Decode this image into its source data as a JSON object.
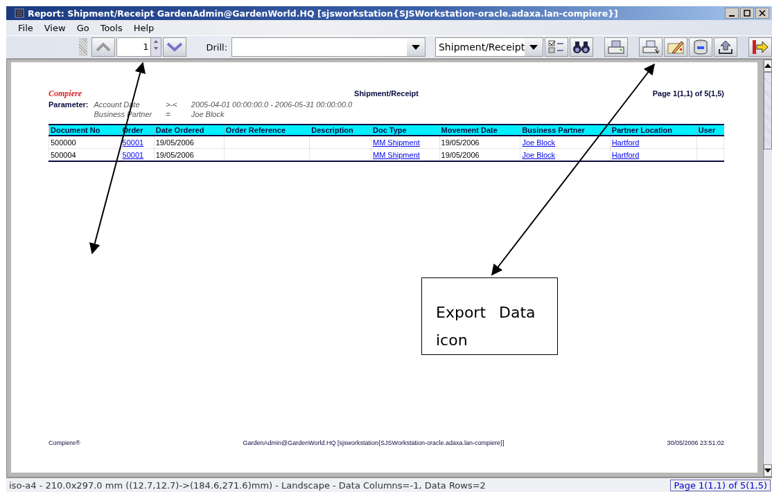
{
  "window": {
    "title": "Report: Shipment/Receipt  GardenAdmin@GardenWorld.HQ [sjsworkstation{SJSWorkstation-oracle.adaxa.lan-compiere}]"
  },
  "menu": [
    {
      "label": "File"
    },
    {
      "label": "View"
    },
    {
      "label": "Go"
    },
    {
      "label": "Tools"
    },
    {
      "label": "Help"
    }
  ],
  "toolbar": {
    "page_value": "1",
    "drill_label": "Drill:",
    "report_select": "Shipment/Receipt"
  },
  "report": {
    "logo": "Compiere",
    "title": "Shipment/Receipt",
    "page": "Page 1(1,1) of 5(1,5)",
    "parameter_label": "Parameter:",
    "parameters": [
      {
        "name": "Account Date",
        "op": ">-<",
        "value": "2005-04-01 00:00:00.0 - 2006-05-31 00:00:00.0"
      },
      {
        "name": "Business Partner",
        "op": "=",
        "value": "Joe Block"
      }
    ],
    "table": {
      "columns": [
        "Document No",
        "Order",
        "Date Ordered",
        "Order Reference",
        "Description",
        "Doc Type",
        "Movement Date",
        "Business Partner",
        "Partner Location",
        "User"
      ],
      "rows": [
        [
          {
            "text": "500000",
            "link": false
          },
          {
            "text": "50001",
            "link": true
          },
          {
            "text": "19/05/2006",
            "link": false
          },
          null,
          null,
          {
            "text": "MM Shipment",
            "link": true
          },
          {
            "text": "19/05/2006",
            "link": false
          },
          {
            "text": "Joe Block",
            "link": true
          },
          {
            "text": "Hartford",
            "link": true
          },
          null
        ],
        [
          {
            "text": "500004",
            "link": false
          },
          {
            "text": "50001",
            "link": true
          },
          {
            "text": "19/05/2006",
            "link": false
          },
          null,
          null,
          {
            "text": "MM Shipment",
            "link": true
          },
          {
            "text": "19/05/2006",
            "link": false
          },
          {
            "text": "Joe Block",
            "link": true
          },
          {
            "text": "Hartford",
            "link": true
          },
          null
        ]
      ]
    },
    "footer": {
      "left": "Compiere®",
      "center": "GardenAdmin@GardenWorld.HQ [sjsworkstation{SJSWorkstation-oracle.adaxa.lan-compiere}]",
      "right": "30/05/2006 23:51:02"
    }
  },
  "callout": {
    "text": "Export Data icon"
  },
  "status_bar": {
    "left": "iso-a4 - 210.0x297.0 mm ((12.7,12.7)->(184.6,271.6)mm) - Landscape - Data Columns=-1, Data Rows=2",
    "right": "Page 1(1,1) of 5(1,5)"
  }
}
